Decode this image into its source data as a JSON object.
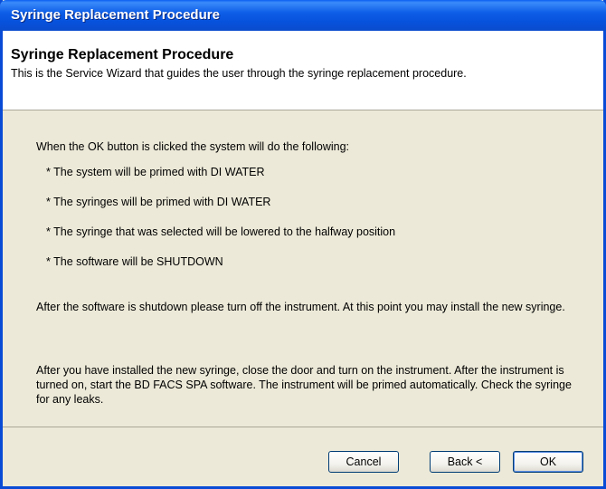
{
  "window": {
    "title": "Syringe Replacement Procedure"
  },
  "header": {
    "title": "Syringe Replacement Procedure",
    "description": "This is the Service Wizard that guides the user through the syringe replacement procedure."
  },
  "content": {
    "intro": "When the OK button is clicked the system will do the following:",
    "bullets": [
      "* The system will be primed with DI WATER",
      "* The syringes will be primed with DI WATER",
      "* The syringe that was selected will be lowered to the halfway position",
      "* The software will be SHUTDOWN"
    ],
    "paragraph1": "After the software is shutdown please turn off the instrument. At this point you may install the new syringe.",
    "paragraph2": "After you have installed the new syringe, close the door and turn on the instrument. After the instrument is turned on, start the BD FACS SPA software. The instrument will be primed automatically. Check the syringe for any leaks."
  },
  "buttons": {
    "cancel": "Cancel",
    "back": "Back <",
    "ok": "OK"
  },
  "colors": {
    "titlebar": "#0a5ff0",
    "dialog_background": "#ece9d8",
    "header_background": "#ffffff",
    "button_border": "#003c74"
  }
}
